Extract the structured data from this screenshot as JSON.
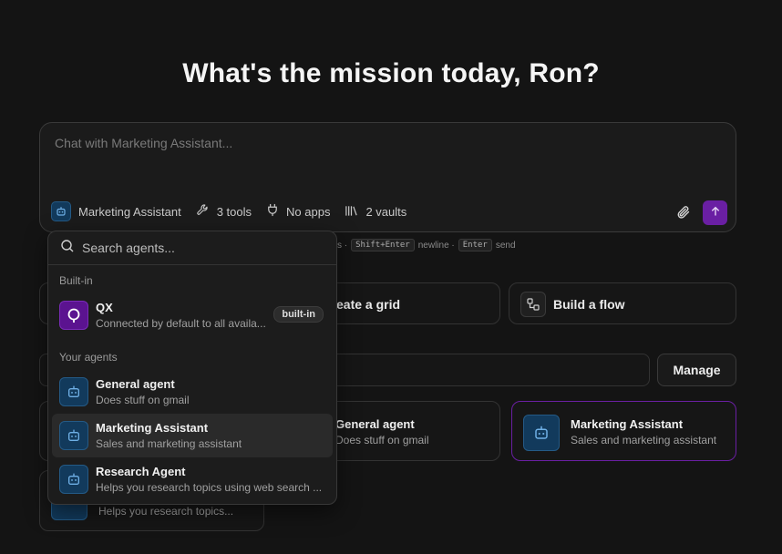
{
  "heading": "What's the mission today, Ron?",
  "composer": {
    "placeholder": "Chat with Marketing Assistant...",
    "agent": "Marketing Assistant",
    "tools": "3 tools",
    "apps": "No apps",
    "vaults": "2 vaults"
  },
  "hint": {
    "sep1": "s ·",
    "key1": "Shift+Enter",
    "text1": "newline ·",
    "key2": "Enter",
    "text2": "send"
  },
  "actions": {
    "grid": "eate a grid",
    "flow": "Build a flow"
  },
  "manage_label": "Manage",
  "cards": [
    {
      "name": "General agent",
      "desc": "Does stuff on gmail"
    },
    {
      "name": "Marketing Assistant",
      "desc": "Sales and marketing assistant"
    },
    {
      "desc": "Helps you research topics..."
    }
  ],
  "dropdown": {
    "search_placeholder": "Search agents...",
    "builtin_label": "Built-in",
    "your_agents_label": "Your agents",
    "builtin": {
      "name": "QX",
      "desc": "Connected by default to all availa...",
      "badge": "built-in"
    },
    "agents": [
      {
        "name": "General agent",
        "desc": "Does stuff on gmail"
      },
      {
        "name": "Marketing Assistant",
        "desc": "Sales and marketing assistant"
      },
      {
        "name": "Research Agent",
        "desc": "Helps you research topics using web search ..."
      }
    ]
  },
  "colors": {
    "background": "#141414",
    "accent": "#6a1fa3",
    "agent_icon_bg": "#123a5c",
    "selected_border": "#6a1fa3"
  }
}
